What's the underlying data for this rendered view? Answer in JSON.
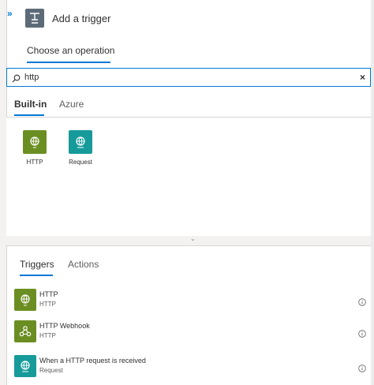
{
  "header": {
    "title": "Add a trigger",
    "expand_glyph": "»",
    "icon": "trigger-icon"
  },
  "operation_tab": {
    "label": "Choose an operation"
  },
  "search": {
    "value": "http",
    "placeholder": "",
    "clear_glyph": "×"
  },
  "connector_tabs": [
    {
      "label": "Built-in",
      "selected": true
    },
    {
      "label": "Azure",
      "selected": false
    }
  ],
  "connectors": [
    {
      "label": "HTTP",
      "color": "#6b8e23",
      "icon": "globe-icon"
    },
    {
      "label": "Request",
      "color": "#179a9a",
      "icon": "request-globe-icon"
    }
  ],
  "collapse_glyph": "⌄",
  "operation_tabs": [
    {
      "label": "Triggers",
      "selected": true
    },
    {
      "label": "Actions",
      "selected": false
    }
  ],
  "operations": [
    {
      "name": "HTTP",
      "connector": "HTTP",
      "color": "#6b8e23",
      "icon": "globe-icon"
    },
    {
      "name": "HTTP Webhook",
      "connector": "HTTP",
      "color": "#6b8e23",
      "icon": "webhook-icon"
    },
    {
      "name": "When a HTTP request is received",
      "connector": "Request",
      "color": "#179a9a",
      "icon": "request-globe-icon"
    }
  ]
}
